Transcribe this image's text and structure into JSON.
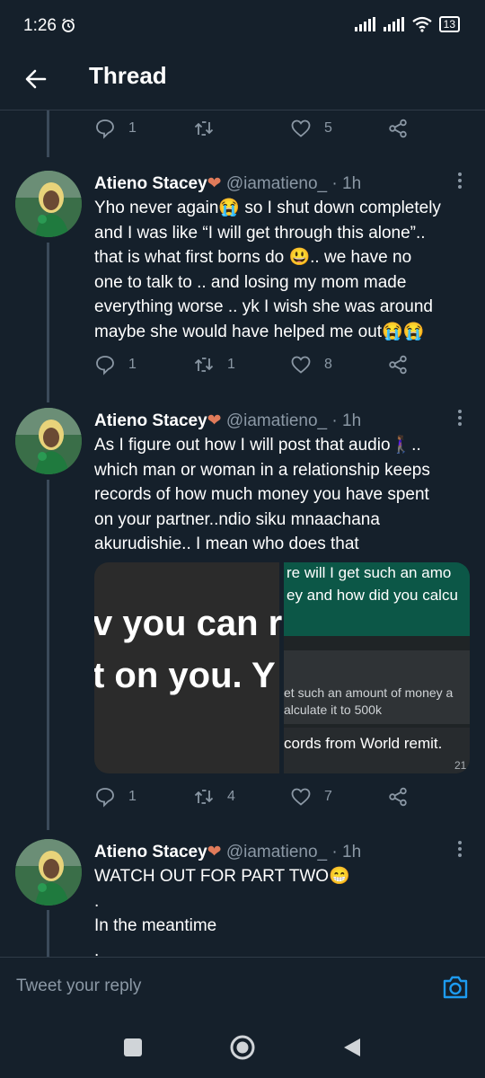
{
  "status_bar": {
    "time": "1:26",
    "battery": "13"
  },
  "header": {
    "title": "Thread"
  },
  "top_actions": {
    "replies": "1",
    "retweets": "",
    "likes": "5"
  },
  "tweets": [
    {
      "name": "Atieno Stacey",
      "handle": "@iamatieno_",
      "time": "· 1h",
      "lines": [
        "Yho never again😭 so I shut down completely",
        "and I was like “I will get through this alone”..",
        "that is what first borns do 😃.. we have no",
        "one to talk to .. and losing my mom made",
        "everything worse .. yk I wish she was around",
        "maybe she would have helped me out😭😭"
      ],
      "replies": "1",
      "retweets": "1",
      "likes": "8"
    },
    {
      "name": "Atieno Stacey",
      "handle": "@iamatieno_",
      "time": "· 1h",
      "lines": [
        "As I figure out how I will post that audio🚶🏾‍♀️..",
        "which man or woman in a relationship keeps",
        "records of how much money you have spent",
        "on your partner..ndio siku mnaachana",
        "akurudishie.. I mean who does that"
      ],
      "media": {
        "left_line1": "v you can r",
        "left_line2": "t on you. Y",
        "right_green_line1": "re will I get such an amo",
        "right_green_line2": "ey and how did you calcu",
        "right_grey_line1": "et such an amount of money a",
        "right_grey_line2": "alculate it to 500k",
        "right_bottom_line": "cords from World remit.",
        "right_number": "21"
      },
      "replies": "1",
      "retweets": "4",
      "likes": "7"
    },
    {
      "name": "Atieno Stacey",
      "handle": "@iamatieno_",
      "time": "· 1h",
      "lines": [
        "WATCH OUT FOR PART TWO😁",
        ".",
        "In the meantime",
        "."
      ]
    }
  ],
  "reply_box": {
    "placeholder": "Tweet your reply"
  }
}
